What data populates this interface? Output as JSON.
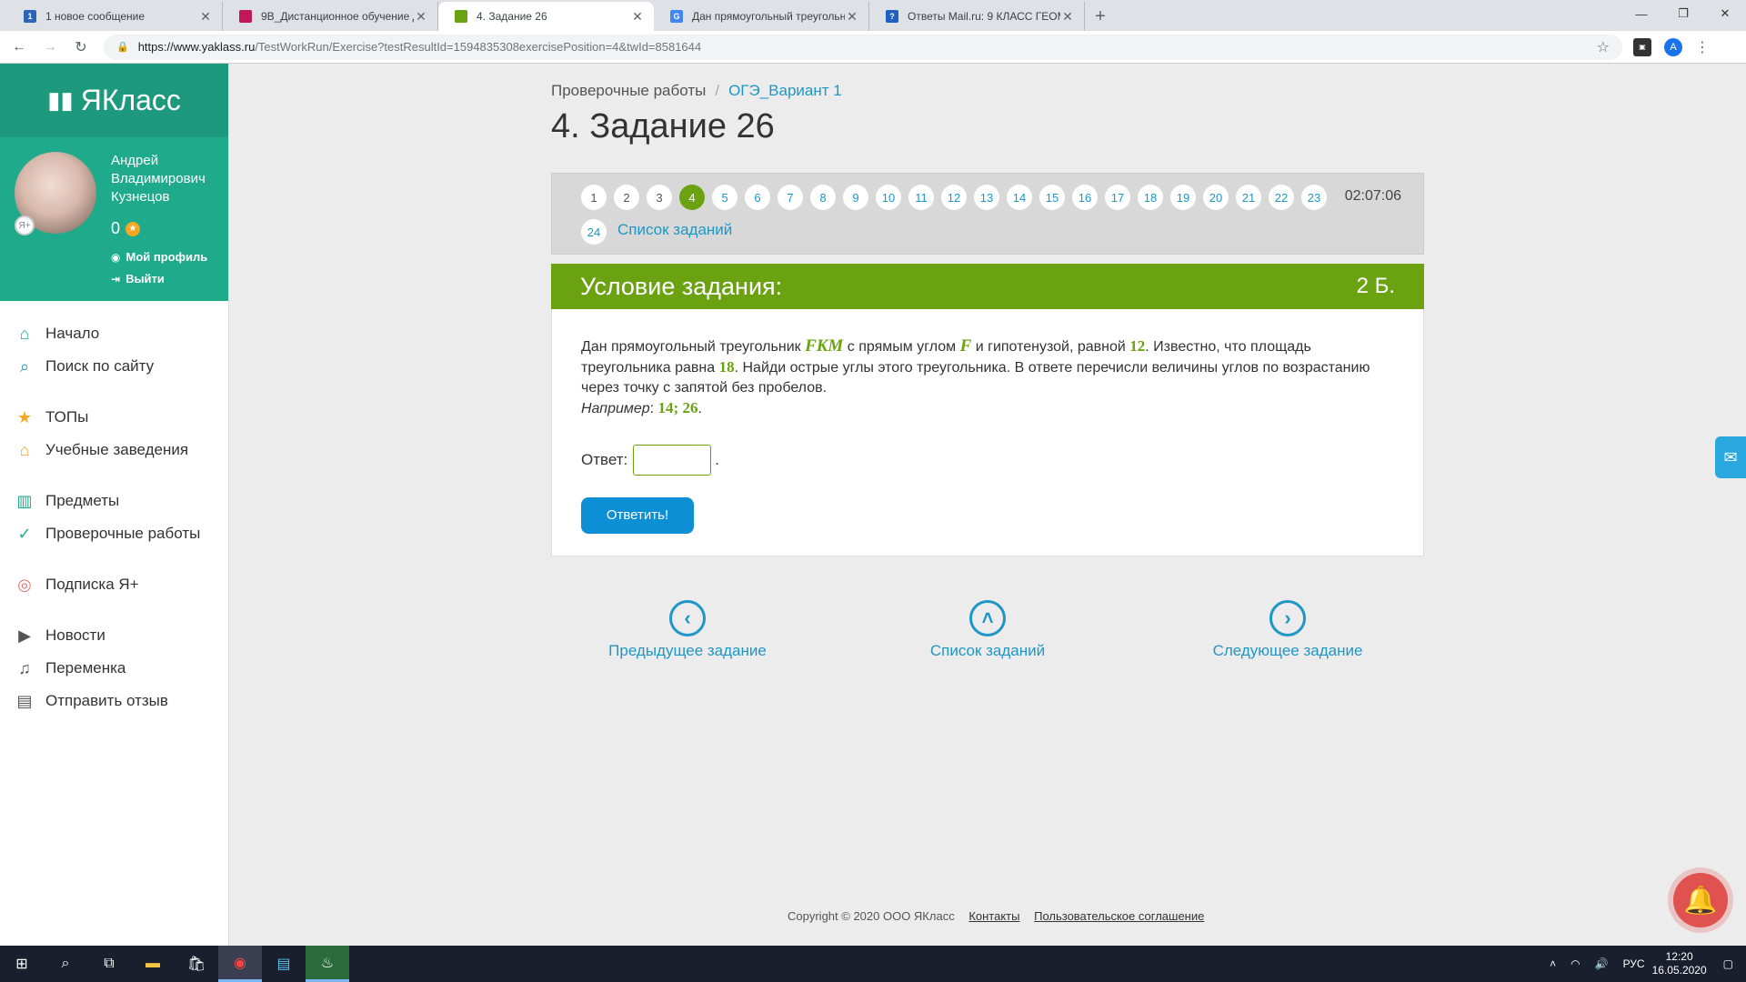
{
  "browser": {
    "tabs": [
      {
        "title": "1 новое сообщение",
        "fav": "1",
        "fav_color": "#2c65b7"
      },
      {
        "title": "9В_Дистанционное обучение д",
        "fav": "",
        "fav_color": "#c2185b"
      },
      {
        "title": "4. Задание 26",
        "fav": "",
        "fav_color": "#6aa211"
      },
      {
        "title": "Дан прямоугольный треугольни",
        "fav": "G",
        "fav_color": "#4285f4"
      },
      {
        "title": "Ответы Mail.ru: 9 КЛАСС ГЕОМЕ",
        "fav": "?",
        "fav_color": "#1e5fbf"
      }
    ],
    "url_host": "https://www.yaklass.ru",
    "url_path": "/TestWorkRun/Exercise?testResultId=1594835308exercisePosition=4&twId=8581644",
    "profile_letter": "A"
  },
  "sidebar": {
    "logo": "ЯКласс",
    "user_name": "Андрей Владимирович Кузнецов",
    "score": "0",
    "badge": "Я+",
    "profile_link": "Мой профиль",
    "logout_link": "Выйти",
    "items": [
      {
        "label": "Начало",
        "icon": "home-icon"
      },
      {
        "label": "Поиск по сайту",
        "icon": "search-icon"
      },
      {
        "label": "ТОПы",
        "icon": "star-icon"
      },
      {
        "label": "Учебные заведения",
        "icon": "school-icon"
      },
      {
        "label": "Предметы",
        "icon": "books-icon"
      },
      {
        "label": "Проверочные работы",
        "icon": "check-icon"
      },
      {
        "label": "Подписка Я+",
        "icon": "subscription-icon"
      },
      {
        "label": "Новости",
        "icon": "news-icon"
      },
      {
        "label": "Переменка",
        "icon": "bell-icon"
      },
      {
        "label": "Отправить отзыв",
        "icon": "feedback-icon"
      }
    ]
  },
  "main": {
    "breadcrumb_root": "Проверочные работы",
    "breadcrumb_current": "ОГЭ_Вариант 1",
    "title": "4. Задание 26",
    "numbers": [
      "1",
      "2",
      "3",
      "4",
      "5",
      "6",
      "7",
      "8",
      "9",
      "10",
      "11",
      "12",
      "13",
      "14",
      "15",
      "16",
      "17",
      "18",
      "19",
      "20",
      "21",
      "22",
      "23"
    ],
    "num_last": "24",
    "timer": "02:07:06",
    "task_list_link": "Список заданий",
    "condition_title": "Условие задания:",
    "points": "2 Б.",
    "text1": "Дан прямоугольный треугольник",
    "math_tri": "FKM",
    "text2": "с прямым углом",
    "math_angle": "F",
    "text3": "и гипотенузой, равной",
    "math_hyp": "12",
    "text4": ". Известно, что площадь треугольника равна",
    "math_area": "18",
    "text5": ". Найди острые углы этого треугольника. В ответе перечисли величины углов по возрастанию через точку с запятой без пробелов.",
    "example_label": "Например",
    "example_val": "14; 26",
    "answer_label": "Ответ:",
    "answer_value": "",
    "submit_label": "Ответить!",
    "prev_label": "Предыдущее задание",
    "list_label": "Список заданий",
    "next_label": "Следующее задание"
  },
  "footer": {
    "copyright": "Copyright © 2020 ООО ЯКласс",
    "contacts": "Контакты",
    "agreement": "Пользовательское соглашение"
  },
  "taskbar": {
    "lang": "РУС",
    "time": "12:20",
    "date": "16.05.2020"
  }
}
